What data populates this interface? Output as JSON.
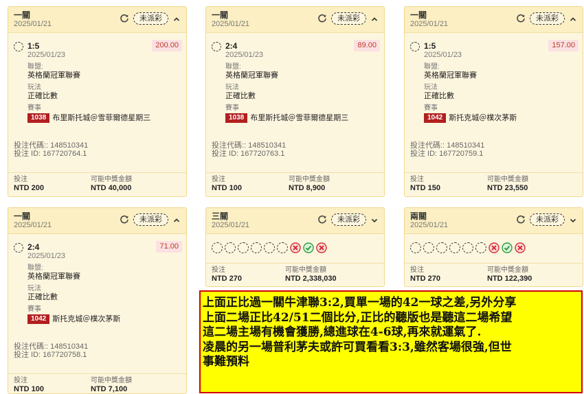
{
  "status_badge": "未派彩",
  "labels": {
    "league": "聯盟:",
    "bet_type": "玩法",
    "event": "賽事",
    "bet_code": "投注代碼:: ",
    "bet_id": "投注 ID: ",
    "stake": "投注",
    "payout": "可能中獎金額"
  },
  "cards": [
    {
      "title": "一關",
      "date": "2025/01/21",
      "leg": {
        "score": "1:5",
        "date": "2025/01/23",
        "odds": "200.00",
        "league": "英格蘭冠軍聯賽",
        "bet_type": "正確比數",
        "event_code": "1038",
        "event_name": "布里斯托城＠雪菲爾德星期三"
      },
      "bet_code": "148510341",
      "bet_id": "167720764.1",
      "stake": "NTD 200",
      "payout": "NTD 40,000"
    },
    {
      "title": "一關",
      "date": "2025/01/21",
      "leg": {
        "score": "2:4",
        "date": "2025/01/23",
        "odds": "89.00",
        "league": "英格蘭冠軍聯賽",
        "bet_type": "正確比數",
        "event_code": "1038",
        "event_name": "布里斯托城＠雪菲爾德星期三"
      },
      "bet_code": "148510341",
      "bet_id": "167720763.1",
      "stake": "NTD 100",
      "payout": "NTD 8,900"
    },
    {
      "title": "一關",
      "date": "2025/01/21",
      "leg": {
        "score": "1:5",
        "date": "2025/01/23",
        "odds": "157.00",
        "league": "英格蘭冠軍聯賽",
        "bet_type": "正確比數",
        "event_code": "1042",
        "event_name": "斯托克城＠樸次茅斯"
      },
      "bet_code": "148510341",
      "bet_id": "167720759.1",
      "stake": "NTD 150",
      "payout": "NTD 23,550"
    },
    {
      "title": "一關",
      "date": "2025/01/21",
      "leg": {
        "score": "2:4",
        "date": "2025/01/23",
        "odds": "71.00",
        "league": "英格蘭冠軍聯賽",
        "bet_type": "正確比數",
        "event_code": "1042",
        "event_name": "斯托克城＠樸次茅斯"
      },
      "bet_code": "148510341",
      "bet_id": "167720758.1",
      "stake": "NTD 100",
      "payout": "NTD 7,100"
    }
  ],
  "parlays": [
    {
      "title": "三關",
      "date": "2025/01/21",
      "stake": "NTD 270",
      "payout": "NTD 2,338,030",
      "legs": [
        "pending",
        "pending",
        "pending",
        "pending",
        "pending",
        "pending",
        "lost",
        "won",
        "lost"
      ]
    },
    {
      "title": "兩關",
      "date": "2025/01/21",
      "stake": "NTD 270",
      "payout": "NTD 122,390",
      "legs": [
        "pending",
        "pending",
        "pending",
        "pending",
        "pending",
        "pending",
        "lost",
        "won",
        "lost"
      ]
    }
  ],
  "note": {
    "lines": [
      "上面正比過一關牛津聯3:2,買單一場的42一球之差,另外分享",
      "上面二場正比42/51二個比分,正比的聽版也是聽這二場希望",
      "這二場主場有機會獲勝,總進球在4-6球,再來就運氣了.",
      "凌晨的另一場普利茅夫或許可買看看3:3,雖然客場很強,但世",
      "事難預料"
    ]
  },
  "colors": {
    "card_bg": "#fdf6df",
    "header_bg": "#fbefc3",
    "border": "#f0d98c",
    "odds_text": "#c0392b",
    "event_code_bg": "#b21f1f",
    "note_bg": "#ffff00",
    "note_border": "#d00000",
    "won": "#2e9e3e",
    "lost": "#d62f2f"
  },
  "icons": {
    "refresh": "refresh-icon",
    "expand_up": "chevron-up-icon",
    "expand_down": "chevron-down-icon",
    "pending": "dashed-circle-icon",
    "won": "check-circle-icon",
    "lost": "x-circle-icon"
  }
}
